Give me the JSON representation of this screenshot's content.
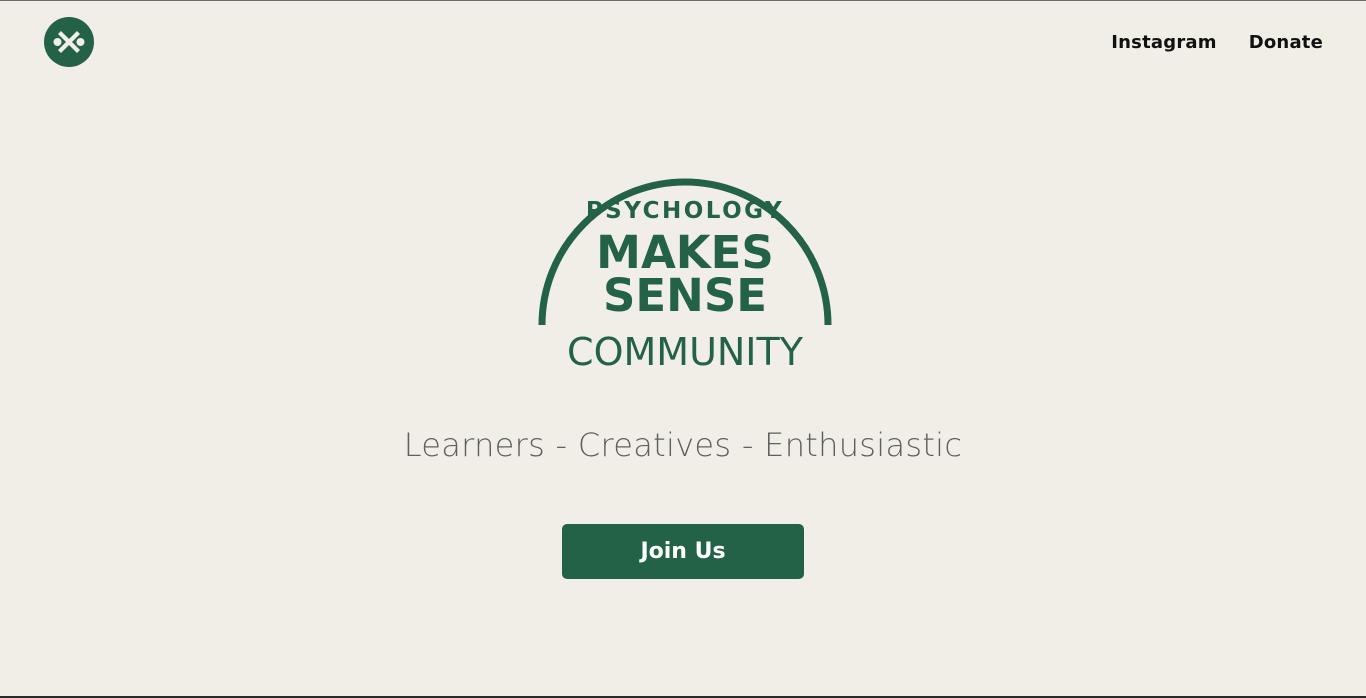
{
  "header": {
    "logo_icon": "community-mark-icon",
    "nav": [
      {
        "label": "Instagram"
      },
      {
        "label": "Donate"
      }
    ]
  },
  "hero": {
    "logo": {
      "line1": "PSYCHOLOGY",
      "line2": "MAKES",
      "line3": "SENSE",
      "line4": "COMMUNITY"
    },
    "tagline": "Learners - Creatives - Enthusiastic",
    "cta_label": "Join Us"
  },
  "colors": {
    "background": "#f1eee7",
    "brand_green": "#236246",
    "text_dark": "#111111",
    "tagline_gray": "#5f5f5f"
  }
}
